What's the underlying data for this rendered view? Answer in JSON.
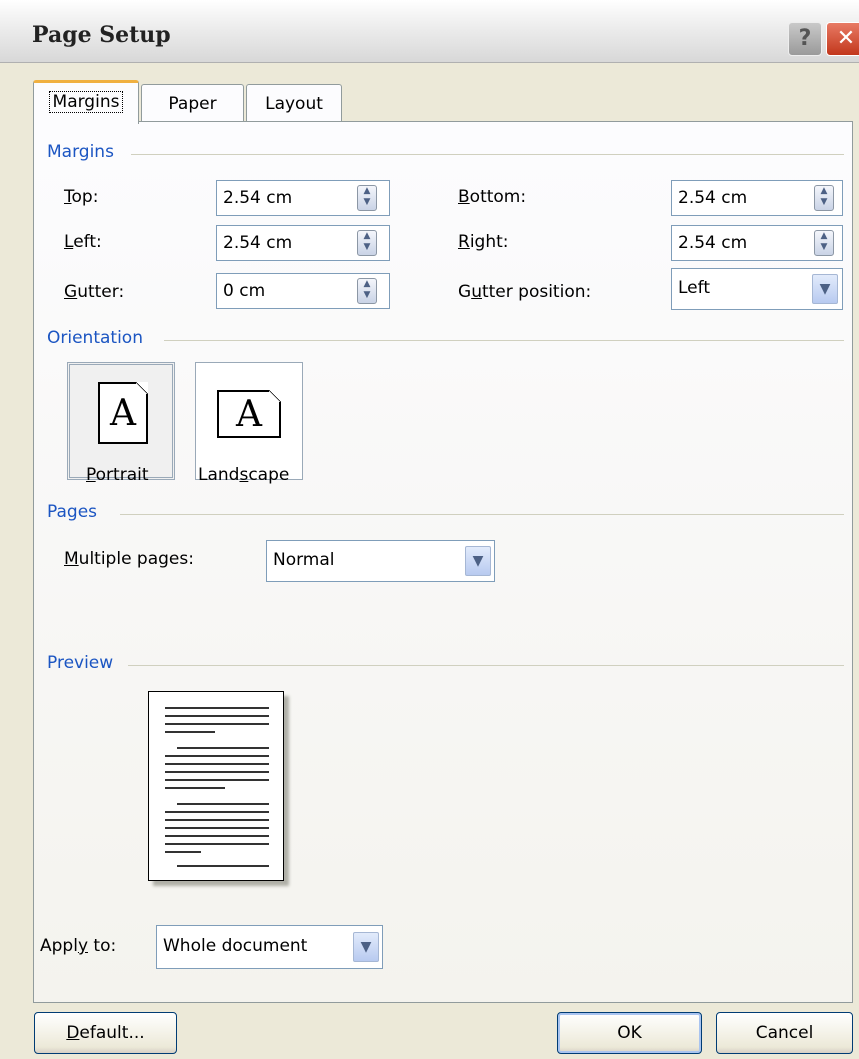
{
  "window": {
    "title": "Page Setup",
    "help_glyph": "?",
    "close_glyph": "✕"
  },
  "tabs": [
    {
      "label": "Margins",
      "active": true
    },
    {
      "label": "Paper",
      "active": false
    },
    {
      "label": "Layout",
      "active": false
    }
  ],
  "margins": {
    "heading": "Margins",
    "top": {
      "label": "Top:",
      "value": "2.54 cm"
    },
    "bottom": {
      "label": "Bottom:",
      "value": "2.54 cm"
    },
    "left": {
      "label": "Left:",
      "value": "2.54 cm"
    },
    "right": {
      "label": "Right:",
      "value": "2.54 cm"
    },
    "gutter": {
      "label": "Gutter:",
      "value": "0 cm"
    },
    "gutter_position": {
      "label": "Gutter position:",
      "value": "Left"
    }
  },
  "orientation": {
    "heading": "Orientation",
    "portrait_label": "Portrait",
    "landscape_label": "Landscape",
    "icon_letter": "A",
    "selected": "Portrait"
  },
  "pages": {
    "heading": "Pages",
    "multiple_pages_label": "Multiple pages:",
    "multiple_pages_value": "Normal"
  },
  "preview": {
    "heading": "Preview",
    "apply_to_label": "Apply to:",
    "apply_to_value": "Whole document"
  },
  "buttons": {
    "default": "Default...",
    "ok": "OK",
    "cancel": "Cancel"
  },
  "colors": {
    "group_heading": "#1b55c2",
    "dialog_bg": "#ece9d8",
    "tab_highlight": "#f0b040"
  },
  "icons": {
    "spin": "spin-updown-icon",
    "dropdown": "chevron-down-icon"
  }
}
